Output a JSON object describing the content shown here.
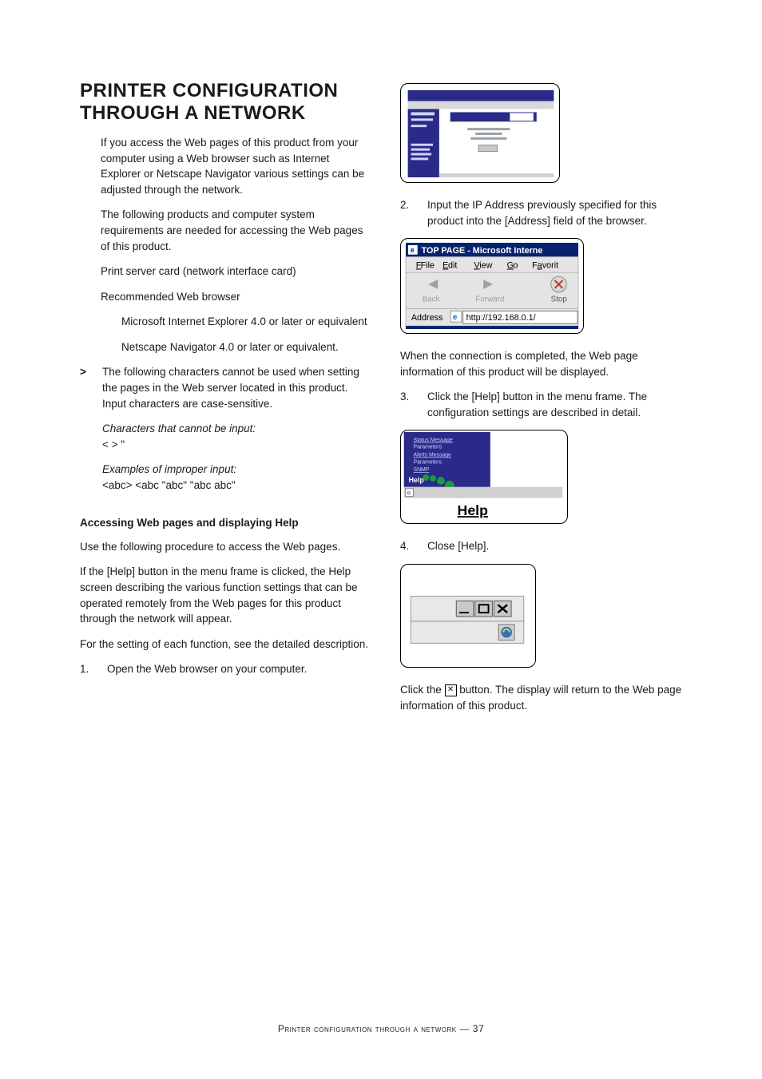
{
  "heading": "PRINTER CONFIGURATION THROUGH A NETWORK",
  "left": {
    "intro": "If you access the Web pages of this product from your computer using a Web browser such as Internet Explorer or Netscape Navigator various settings can be adjusted through the network.",
    "req_lead": "The following products and computer system requirements are needed for accessing the Web pages of this product.",
    "req_a": "Print server card (network interface card)",
    "req_b": "Recommended Web browser",
    "req_b1": "Microsoft Internet Explorer 4.0 or later or equivalent",
    "req_b2": "Netscape Navigator 4.0 or later or equivalent.",
    "note_glyph": ">",
    "note_text": "The following characters cannot be used when setting the pages in the Web server located in this product. Input characters are case-sensitive.",
    "note_em1": "Characters that cannot be input:",
    "note_chars": "< > \"",
    "note_em2": "Examples of improper input:",
    "note_ex": "<abc> <abc \"abc\" \"abc abc\"",
    "access_head": "Accessing Web pages and displaying Help",
    "access_p1": "Use the following procedure to access the Web pages.",
    "access_p2": "If the [Help] button in the menu frame is clicked, the Help screen describing the various function settings that can be operated remotely from the Web pages for this product through the network will appear.",
    "access_p3": "For the setting of each function, see the detailed description.",
    "step1_n": "1.",
    "step1_t": "Open the Web browser on your computer."
  },
  "right": {
    "step2_n": "2.",
    "step2_t": "Input the IP Address previously specified for this product into the [Address] field of the browser.",
    "browser_title": "TOP PAGE - Microsoft Interne",
    "menu_file": "File",
    "menu_edit": "Edit",
    "menu_view": "View",
    "menu_go": "Go",
    "menu_fav": "Favorit",
    "tb_back": "Back",
    "tb_fwd": "Forward",
    "tb_stop": "Stop",
    "addr_label": "Address",
    "addr_url": "http://192.168.0.1/",
    "after_conn": "When the connection is completed, the Web page information of this product will be displayed.",
    "step3_n": "3.",
    "step3_t": "Click the [Help] button in the menu frame. The configuration settings are described in detail.",
    "help_side1": "Status Message",
    "help_side2": "Parameters",
    "help_side3": "Alerts Message",
    "help_side4": "Parameters",
    "help_side5": "SNMP",
    "help_btn": "Help",
    "help_big": "Help",
    "step4_n": "4.",
    "step4_t": "Close [Help].",
    "close_para_a": "Click the ",
    "close_para_b": " button. The display will return to the Web page information of this product.",
    "close_glyph": "✕"
  },
  "footer": "Printer configuration through a network — 37"
}
